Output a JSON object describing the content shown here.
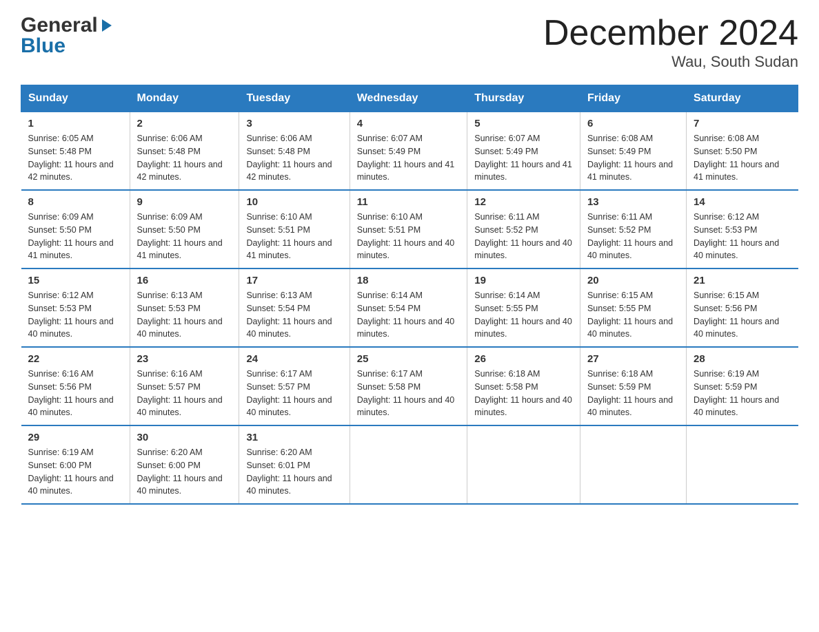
{
  "logo": {
    "general": "General",
    "blue": "Blue",
    "arrow": "▶"
  },
  "title": "December 2024",
  "subtitle": "Wau, South Sudan",
  "headers": [
    "Sunday",
    "Monday",
    "Tuesday",
    "Wednesday",
    "Thursday",
    "Friday",
    "Saturday"
  ],
  "weeks": [
    [
      {
        "day": "1",
        "sunrise": "6:05 AM",
        "sunset": "5:48 PM",
        "daylight": "11 hours and 42 minutes."
      },
      {
        "day": "2",
        "sunrise": "6:06 AM",
        "sunset": "5:48 PM",
        "daylight": "11 hours and 42 minutes."
      },
      {
        "day": "3",
        "sunrise": "6:06 AM",
        "sunset": "5:48 PM",
        "daylight": "11 hours and 42 minutes."
      },
      {
        "day": "4",
        "sunrise": "6:07 AM",
        "sunset": "5:49 PM",
        "daylight": "11 hours and 41 minutes."
      },
      {
        "day": "5",
        "sunrise": "6:07 AM",
        "sunset": "5:49 PM",
        "daylight": "11 hours and 41 minutes."
      },
      {
        "day": "6",
        "sunrise": "6:08 AM",
        "sunset": "5:49 PM",
        "daylight": "11 hours and 41 minutes."
      },
      {
        "day": "7",
        "sunrise": "6:08 AM",
        "sunset": "5:50 PM",
        "daylight": "11 hours and 41 minutes."
      }
    ],
    [
      {
        "day": "8",
        "sunrise": "6:09 AM",
        "sunset": "5:50 PM",
        "daylight": "11 hours and 41 minutes."
      },
      {
        "day": "9",
        "sunrise": "6:09 AM",
        "sunset": "5:50 PM",
        "daylight": "11 hours and 41 minutes."
      },
      {
        "day": "10",
        "sunrise": "6:10 AM",
        "sunset": "5:51 PM",
        "daylight": "11 hours and 41 minutes."
      },
      {
        "day": "11",
        "sunrise": "6:10 AM",
        "sunset": "5:51 PM",
        "daylight": "11 hours and 40 minutes."
      },
      {
        "day": "12",
        "sunrise": "6:11 AM",
        "sunset": "5:52 PM",
        "daylight": "11 hours and 40 minutes."
      },
      {
        "day": "13",
        "sunrise": "6:11 AM",
        "sunset": "5:52 PM",
        "daylight": "11 hours and 40 minutes."
      },
      {
        "day": "14",
        "sunrise": "6:12 AM",
        "sunset": "5:53 PM",
        "daylight": "11 hours and 40 minutes."
      }
    ],
    [
      {
        "day": "15",
        "sunrise": "6:12 AM",
        "sunset": "5:53 PM",
        "daylight": "11 hours and 40 minutes."
      },
      {
        "day": "16",
        "sunrise": "6:13 AM",
        "sunset": "5:53 PM",
        "daylight": "11 hours and 40 minutes."
      },
      {
        "day": "17",
        "sunrise": "6:13 AM",
        "sunset": "5:54 PM",
        "daylight": "11 hours and 40 minutes."
      },
      {
        "day": "18",
        "sunrise": "6:14 AM",
        "sunset": "5:54 PM",
        "daylight": "11 hours and 40 minutes."
      },
      {
        "day": "19",
        "sunrise": "6:14 AM",
        "sunset": "5:55 PM",
        "daylight": "11 hours and 40 minutes."
      },
      {
        "day": "20",
        "sunrise": "6:15 AM",
        "sunset": "5:55 PM",
        "daylight": "11 hours and 40 minutes."
      },
      {
        "day": "21",
        "sunrise": "6:15 AM",
        "sunset": "5:56 PM",
        "daylight": "11 hours and 40 minutes."
      }
    ],
    [
      {
        "day": "22",
        "sunrise": "6:16 AM",
        "sunset": "5:56 PM",
        "daylight": "11 hours and 40 minutes."
      },
      {
        "day": "23",
        "sunrise": "6:16 AM",
        "sunset": "5:57 PM",
        "daylight": "11 hours and 40 minutes."
      },
      {
        "day": "24",
        "sunrise": "6:17 AM",
        "sunset": "5:57 PM",
        "daylight": "11 hours and 40 minutes."
      },
      {
        "day": "25",
        "sunrise": "6:17 AM",
        "sunset": "5:58 PM",
        "daylight": "11 hours and 40 minutes."
      },
      {
        "day": "26",
        "sunrise": "6:18 AM",
        "sunset": "5:58 PM",
        "daylight": "11 hours and 40 minutes."
      },
      {
        "day": "27",
        "sunrise": "6:18 AM",
        "sunset": "5:59 PM",
        "daylight": "11 hours and 40 minutes."
      },
      {
        "day": "28",
        "sunrise": "6:19 AM",
        "sunset": "5:59 PM",
        "daylight": "11 hours and 40 minutes."
      }
    ],
    [
      {
        "day": "29",
        "sunrise": "6:19 AM",
        "sunset": "6:00 PM",
        "daylight": "11 hours and 40 minutes."
      },
      {
        "day": "30",
        "sunrise": "6:20 AM",
        "sunset": "6:00 PM",
        "daylight": "11 hours and 40 minutes."
      },
      {
        "day": "31",
        "sunrise": "6:20 AM",
        "sunset": "6:01 PM",
        "daylight": "11 hours and 40 minutes."
      },
      null,
      null,
      null,
      null
    ]
  ]
}
